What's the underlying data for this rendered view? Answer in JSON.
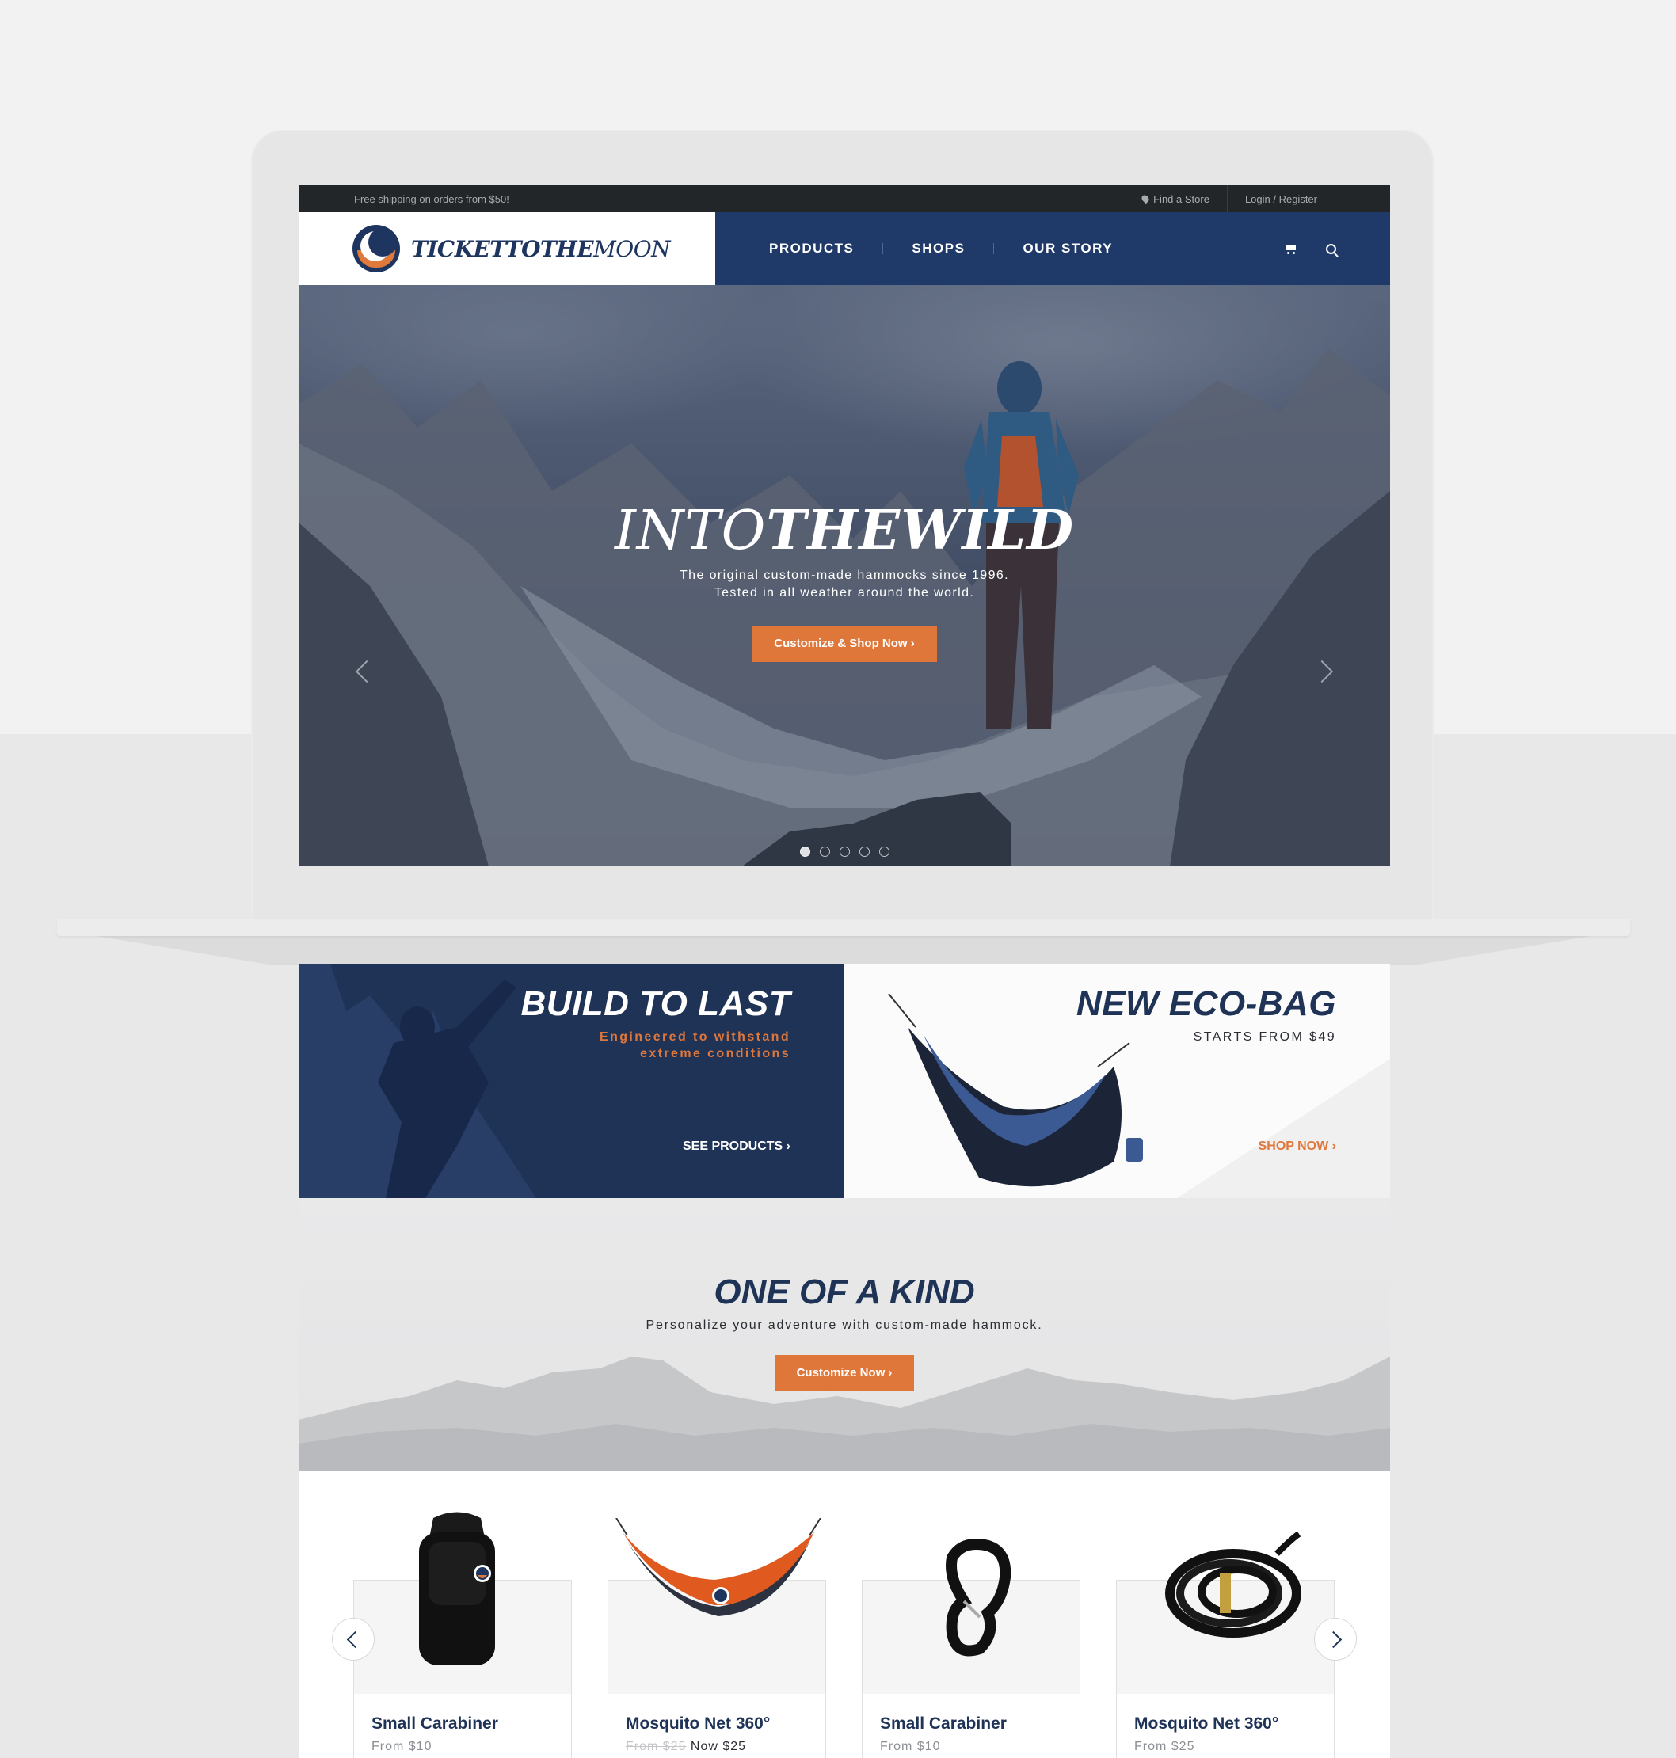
{
  "topbar": {
    "shipping": "Free shipping on orders from $50!",
    "find_store": "Find a Store",
    "login": "Login / Register"
  },
  "brand": {
    "name_bold": "TICKETTOTHE",
    "name_light": "MOON",
    "navy": "#1f3968",
    "orange": "#e0773a"
  },
  "nav": {
    "items": [
      {
        "label": "PRODUCTS"
      },
      {
        "label": "SHOPS"
      },
      {
        "label": "OUR STORY"
      }
    ],
    "icons": [
      "cart-icon",
      "search-icon"
    ]
  },
  "hero": {
    "title_thin": "INTO",
    "title_bold": "THEWILD",
    "sub_line1": "The original custom-made hammocks since 1996.",
    "sub_line2": "Tested in all weather around the world.",
    "cta": "Customize & Shop Now ›",
    "slides": 5,
    "active_slide": 1
  },
  "promo_left": {
    "title": "BUILD TO LAST",
    "sub_line1": "Engineered to withstand",
    "sub_line2": "extreme conditions",
    "link": "SEE PRODUCTS ›"
  },
  "promo_right": {
    "title": "NEW ECO-BAG",
    "sub": "STARTS FROM $49",
    "link": "SHOP NOW ›"
  },
  "kind": {
    "title": "ONE OF A KIND",
    "sub": "Personalize your adventure with custom-made hammock.",
    "cta": "Customize Now ›"
  },
  "products": [
    {
      "name": "Small Carabiner",
      "price": "From $10",
      "icon": "backpack"
    },
    {
      "name": "Mosquito Net 360°",
      "old_price": "From $25",
      "now_price": "Now $25",
      "icon": "hammock"
    },
    {
      "name": "Small Carabiner",
      "price": "From $10",
      "icon": "carabiner"
    },
    {
      "name": "Mosquito Net 360°",
      "price": "From $25",
      "icon": "rope"
    }
  ]
}
